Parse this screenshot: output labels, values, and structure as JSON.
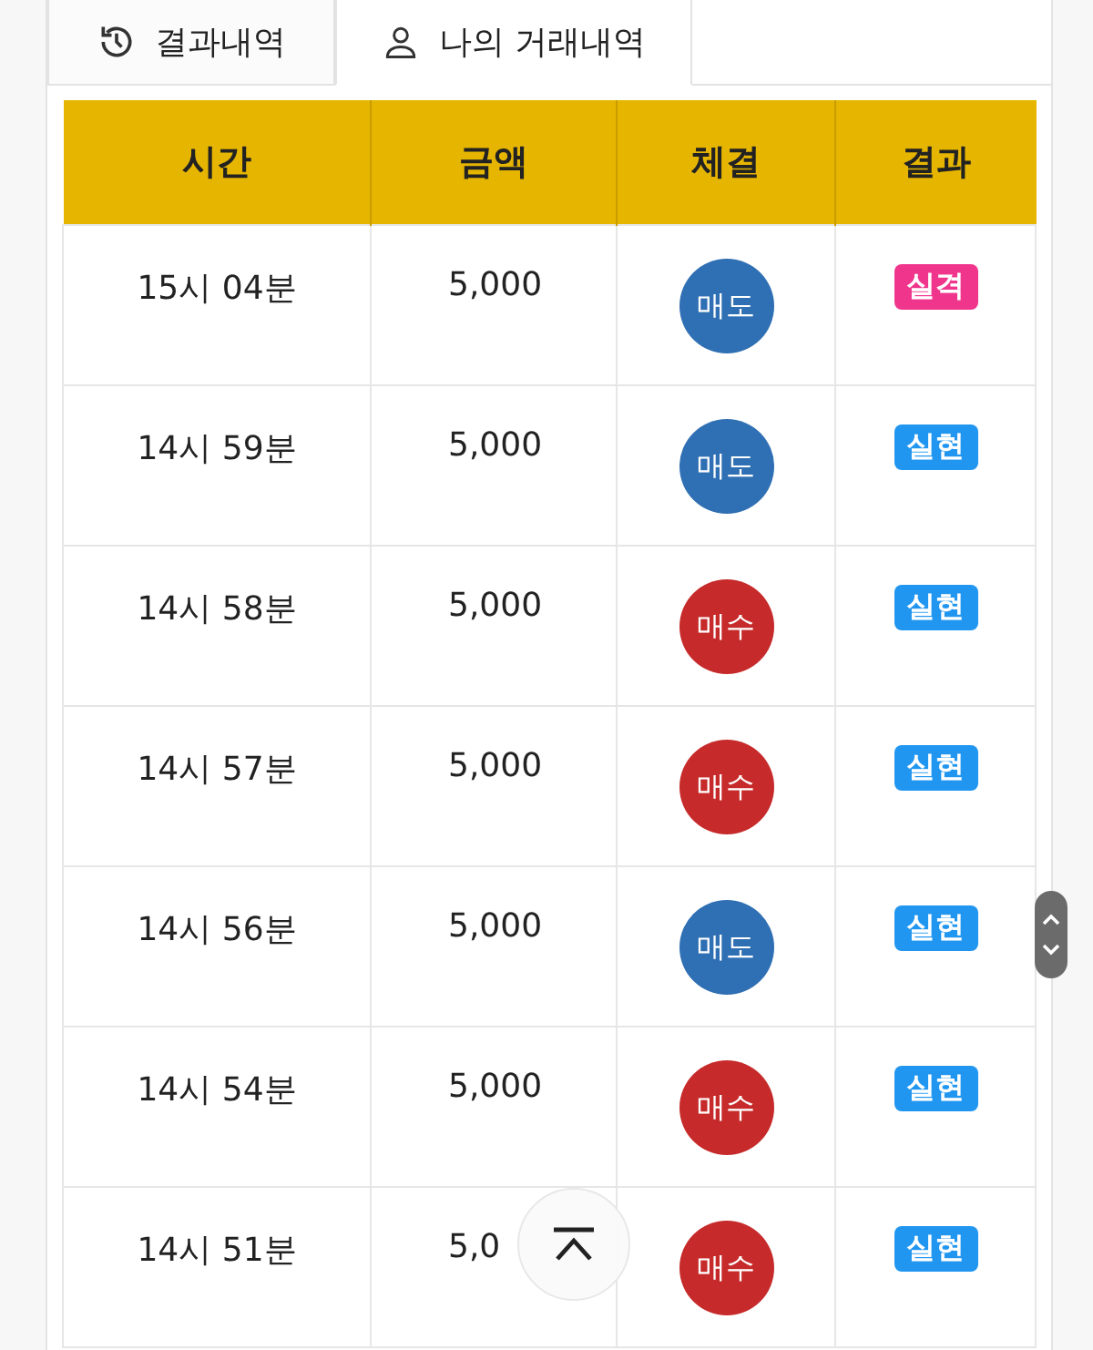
{
  "tabs": [
    {
      "label": "결과내역",
      "kind": "history",
      "selected": false
    },
    {
      "label": "나의 거래내역",
      "kind": "account",
      "selected": true
    }
  ],
  "table": {
    "columns": [
      "시간",
      "금액",
      "체결",
      "결과"
    ],
    "rows": [
      {
        "time": "15시 04분",
        "amount": "5,000",
        "trade": {
          "label": "매도",
          "kind": "sell"
        },
        "result": {
          "label": "실격",
          "kind": "fail"
        }
      },
      {
        "time": "14시 59분",
        "amount": "5,000",
        "trade": {
          "label": "매도",
          "kind": "sell"
        },
        "result": {
          "label": "실현",
          "kind": "success"
        }
      },
      {
        "time": "14시 58분",
        "amount": "5,000",
        "trade": {
          "label": "매수",
          "kind": "buy"
        },
        "result": {
          "label": "실현",
          "kind": "success"
        }
      },
      {
        "time": "14시 57분",
        "amount": "5,000",
        "trade": {
          "label": "매수",
          "kind": "buy"
        },
        "result": {
          "label": "실현",
          "kind": "success"
        }
      },
      {
        "time": "14시 56분",
        "amount": "5,000",
        "trade": {
          "label": "매도",
          "kind": "sell"
        },
        "result": {
          "label": "실현",
          "kind": "success"
        }
      },
      {
        "time": "14시 54분",
        "amount": "5,000",
        "trade": {
          "label": "매수",
          "kind": "buy"
        },
        "result": {
          "label": "실현",
          "kind": "success"
        }
      },
      {
        "time": "14시 51분",
        "amount": "5,0",
        "trade": {
          "label": "매수",
          "kind": "buy"
        },
        "result": {
          "label": "실현",
          "kind": "success"
        }
      }
    ]
  }
}
